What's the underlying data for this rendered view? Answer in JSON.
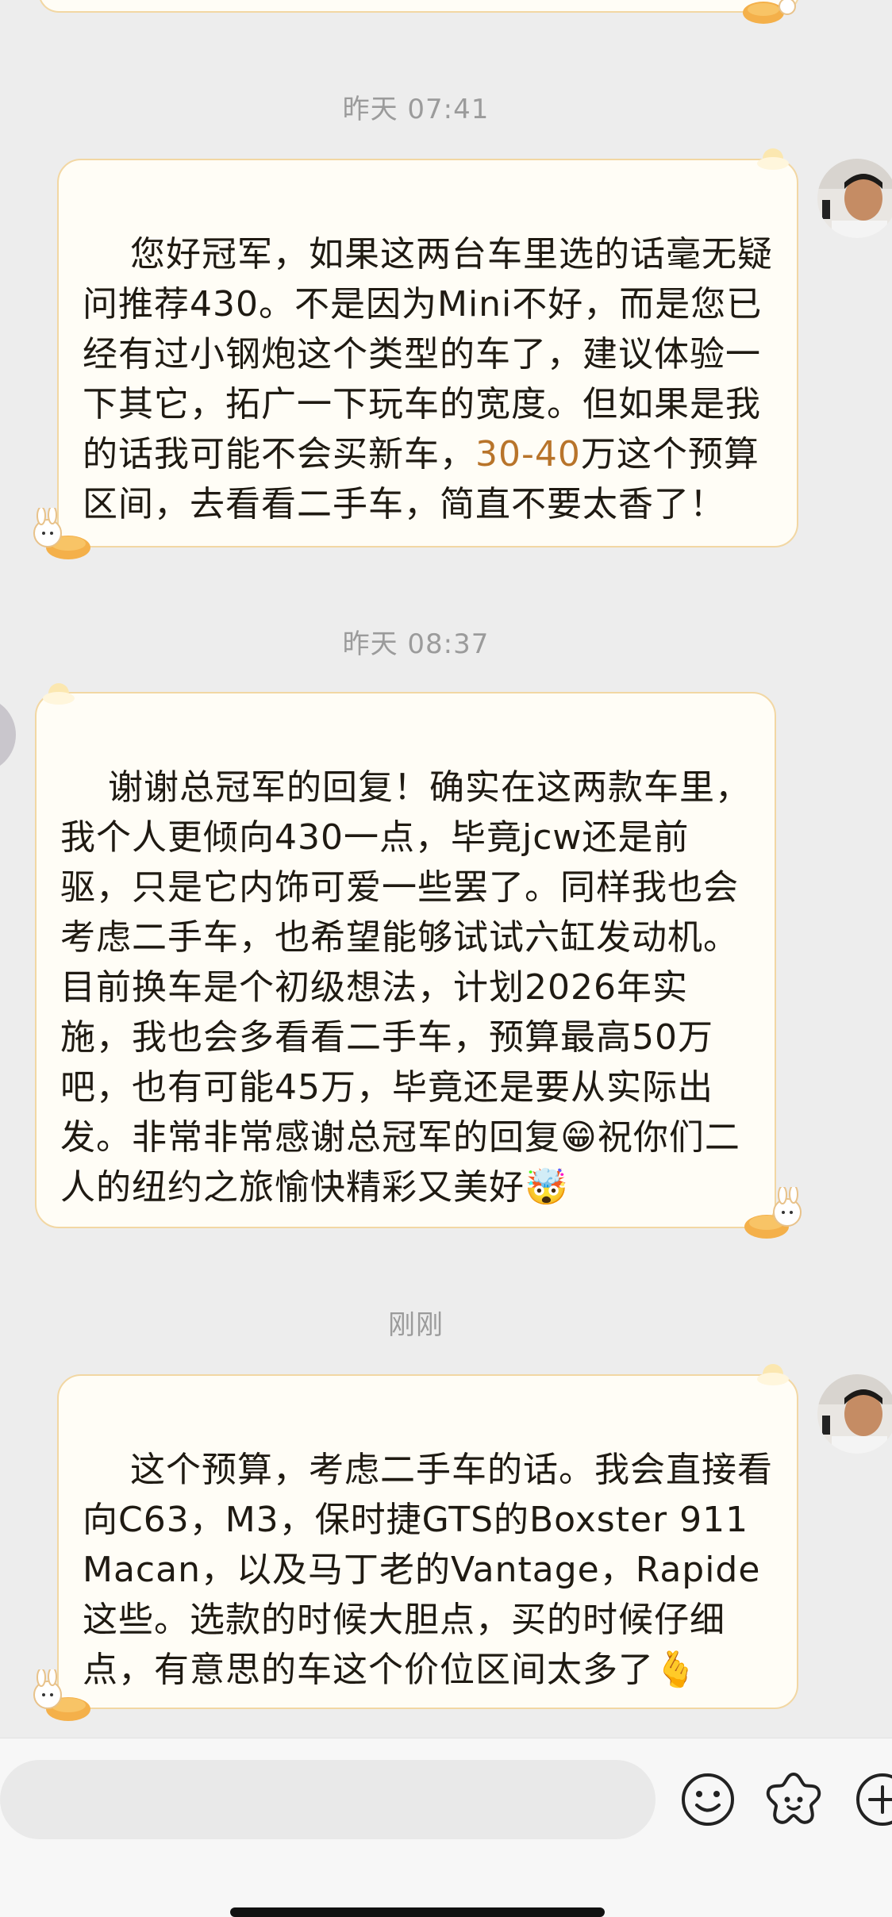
{
  "chat": {
    "messages": [
      {
        "timestamp": "昨天 07:41",
        "sender": "other",
        "text_before": "您好冠军，如果这两台车里选的话毫无疑问推荐430。不是因为Mini不好，而是您已经有过小钢炮这个类型的车了，建议体验一下其它，拓广一下玩车的宽度。但如果是我的话我可能不会买新车，",
        "highlight": "30-40",
        "text_after": "万这个预算区间，去看看二手车，简直不要太香了！"
      },
      {
        "timestamp": "昨天 08:37",
        "sender": "me",
        "text": "谢谢总冠军的回复！确实在这两款车里，我个人更倾向430一点，毕竟jcw还是前驱，只是它内饰可爱一些罢了。同样我也会考虑二手车，也希望能够试试六缸发动机。目前换车是个初级想法，计划2026年实施，我也会多看看二手车，预算最高50万吧，也有可能45万，毕竟还是要从实际出发。非常非常感谢总冠军的回复",
        "emoji1": "😁",
        "text2": "祝你们二人的纽约之旅愉快精彩又美好",
        "emoji2": "🤯"
      },
      {
        "timestamp": "刚刚",
        "sender": "other",
        "text": "这个预算，考虑二手车的话。我会直接看向C63，M3，保时捷GTS的Boxster 911 Macan，以及马丁老的Vantage，Rapide这些。选款的时候大胆点，买的时候仔细点，有意思的车这个价位区间太多了",
        "emoji": "🫰"
      }
    ]
  },
  "colors": {
    "bubble_fill": "#fffdf6",
    "bubble_border": "#f2d7a3",
    "highlight": "#b8742a",
    "background": "#ededed"
  },
  "icons": [
    "emoji-face-icon",
    "sticker-flower-icon",
    "plus-icon",
    "mooncake-rabbit-icon"
  ]
}
